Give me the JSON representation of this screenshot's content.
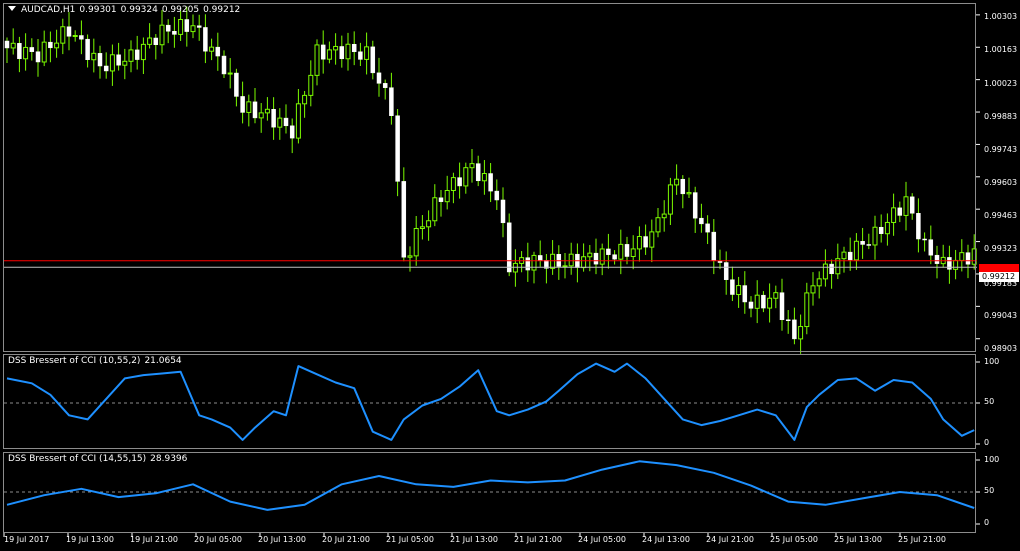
{
  "chart": {
    "symbol_period": "AUDCAD,H1",
    "ohlc": [
      "0.99301",
      "0.99324",
      "0.99205",
      "0.99212"
    ],
    "bid_price": "0.99212",
    "ask_price": "0.99240"
  },
  "indicators": [
    {
      "title": "DSS Bressert of CCI (10,55,2)",
      "value": "21.0654",
      "levels": [
        "100",
        "50",
        "0"
      ]
    },
    {
      "title": "DSS Bressert of CCI (14,55,15)",
      "value": "28.9396",
      "levels": [
        "100",
        "50",
        "0"
      ]
    }
  ],
  "colors": {
    "background": "#000000",
    "candle": "#ffffff",
    "wick": "#7cfc00",
    "bid_line": "#c0c0c0",
    "ask_line": "#ff0000",
    "indicator": "#1e90ff",
    "grid": "#8c8c8c"
  },
  "price_axis": [
    "1.00303",
    "1.00163",
    "1.00023",
    "0.99883",
    "0.99743",
    "0.99603",
    "0.99463",
    "0.99323",
    "0.99183",
    "0.99043",
    "0.98903"
  ],
  "time_axis": [
    "19 Jul 2017",
    "19 Jul 13:00",
    "19 Jul 21:00",
    "20 Jul 05:00",
    "20 Jul 13:00",
    "20 Jul 21:00",
    "21 Jul 05:00",
    "21 Jul 13:00",
    "21 Jul 21:00",
    "24 Jul 05:00",
    "24 Jul 13:00",
    "24 Jul 21:00",
    "25 Jul 05:00",
    "25 Jul 13:00",
    "25 Jul 21:00"
  ],
  "chart_data": [
    {
      "type": "candlestick",
      "title": "AUDCAD,H1",
      "ylim": [
        0.9885,
        1.0035
      ],
      "close_anchors": [
        [
          0,
          1.0016
        ],
        [
          5,
          1.0013
        ],
        [
          10,
          1.0024
        ],
        [
          15,
          1.0008
        ],
        [
          20,
          1.0012
        ],
        [
          25,
          1.0023
        ],
        [
          30,
          1.0026
        ],
        [
          32,
          1.0018
        ],
        [
          35,
          1.0008
        ],
        [
          38,
          0.999
        ],
        [
          42,
          0.9987
        ],
        [
          46,
          0.998
        ],
        [
          50,
          1.0014
        ],
        [
          55,
          1.0015
        ],
        [
          58,
          1.0013
        ],
        [
          62,
          0.999
        ],
        [
          64,
          0.9924
        ],
        [
          66,
          0.9935
        ],
        [
          70,
          0.9952
        ],
        [
          75,
          0.9965
        ],
        [
          79,
          0.9952
        ],
        [
          81,
          0.9922
        ],
        [
          85,
          0.9924
        ],
        [
          90,
          0.9923
        ],
        [
          95,
          0.9926
        ],
        [
          100,
          0.9928
        ],
        [
          104,
          0.9935
        ],
        [
          108,
          0.996
        ],
        [
          112,
          0.994
        ],
        [
          116,
          0.9915
        ],
        [
          120,
          0.9905
        ],
        [
          124,
          0.9908
        ],
        [
          127,
          0.989
        ],
        [
          130,
          0.9915
        ],
        [
          135,
          0.9926
        ],
        [
          140,
          0.9935
        ],
        [
          145,
          0.995
        ],
        [
          148,
          0.993
        ],
        [
          151,
          0.9922
        ],
        [
          156,
          0.9927
        ]
      ]
    },
    {
      "type": "line",
      "title": "DSS Bressert of CCI (10,55,2)",
      "ylim": [
        0,
        100
      ],
      "levels": [
        50
      ],
      "x": [
        0,
        4,
        7,
        10,
        13,
        16,
        19,
        22,
        25,
        28,
        31,
        33,
        36,
        38,
        40,
        43,
        45,
        47,
        50,
        53,
        56,
        59,
        62,
        64,
        67,
        70,
        73,
        76,
        79,
        81,
        84,
        87,
        89,
        92,
        95,
        98,
        100,
        103,
        106,
        109,
        112,
        115,
        118,
        121,
        124,
        127,
        129,
        131,
        134,
        137,
        140,
        143,
        146,
        149,
        151,
        154,
        156
      ],
      "y": [
        80,
        74,
        60,
        35,
        30,
        55,
        80,
        84,
        86,
        88,
        35,
        30,
        20,
        5,
        20,
        40,
        35,
        95,
        85,
        75,
        68,
        15,
        5,
        30,
        47,
        55,
        70,
        90,
        40,
        35,
        42,
        52,
        65,
        85,
        98,
        88,
        98,
        80,
        55,
        30,
        23,
        28,
        35,
        42,
        35,
        5,
        45,
        60,
        78,
        80,
        65,
        78,
        75,
        55,
        30,
        10,
        17
      ]
    },
    {
      "type": "line",
      "title": "DSS Bressert of CCI (14,55,15)",
      "ylim": [
        0,
        100
      ],
      "levels": [
        50
      ],
      "x": [
        0,
        6,
        12,
        18,
        24,
        30,
        36,
        42,
        48,
        54,
        60,
        66,
        72,
        78,
        84,
        90,
        96,
        102,
        108,
        114,
        120,
        126,
        132,
        138,
        144,
        150,
        156
      ],
      "y": [
        30,
        45,
        55,
        42,
        48,
        62,
        35,
        22,
        30,
        62,
        75,
        62,
        58,
        68,
        65,
        68,
        85,
        98,
        92,
        80,
        60,
        35,
        30,
        40,
        50,
        45,
        25
      ]
    }
  ]
}
